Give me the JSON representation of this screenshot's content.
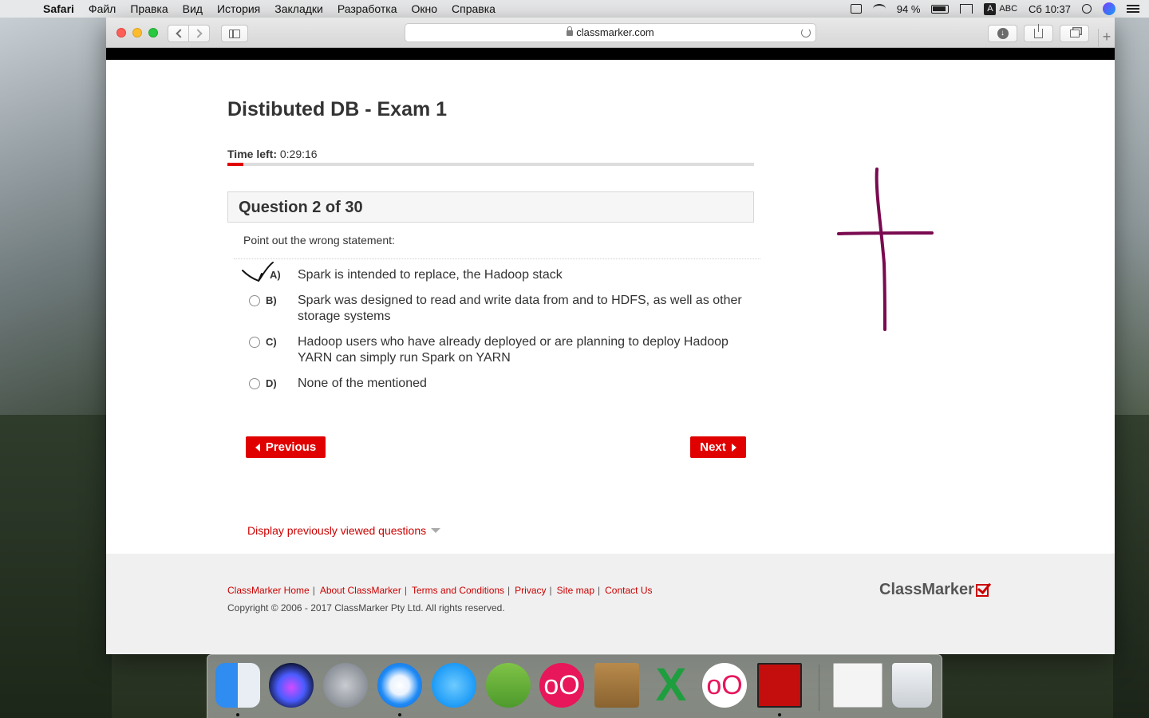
{
  "menubar": {
    "app": "Safari",
    "items": [
      "Файл",
      "Правка",
      "Вид",
      "История",
      "Закладки",
      "Разработка",
      "Окно",
      "Справка"
    ],
    "battery": "94 %",
    "input_source": "ABC",
    "clock": "Сб 10:37"
  },
  "browser": {
    "url": "classmarker.com"
  },
  "exam": {
    "title": "Distibuted DB - Exam 1",
    "time_left_label": "Time left:",
    "time_left_value": "0:29:16",
    "time_progress_fraction": 0.03,
    "question_header": "Question 2 of 30",
    "question_text": "Point out the wrong statement:",
    "answers": [
      {
        "letter": "A)",
        "text": "Spark is intended to replace, the Hadoop stack"
      },
      {
        "letter": "B)",
        "text": "Spark was designed to read and write data from and to HDFS, as well as other storage systems"
      },
      {
        "letter": "C)",
        "text": "Hadoop users who have already deployed or are planning to deploy Hadoop YARN can simply run Spark on YARN"
      },
      {
        "letter": "D)",
        "text": "None of the mentioned"
      }
    ],
    "previous_label": "Previous",
    "next_label": "Next",
    "prev_viewed_label": "Display previously viewed questions"
  },
  "footer": {
    "links": [
      "ClassMarker Home",
      "About ClassMarker",
      "Terms and Conditions",
      "Privacy",
      "Site map",
      "Contact Us"
    ],
    "copyright": "Copyright © 2006 - 2017 ClassMarker Pty Ltd. All rights reserved.",
    "brand": "ClassMarker"
  },
  "colors": {
    "accent_red": "#e00000",
    "annotation_purple": "#7a0a4f"
  },
  "dock": {
    "apps": [
      "finder-icon",
      "siri-icon",
      "launchpad-icon",
      "safari-icon",
      "messages-icon",
      "android-studio-icon",
      "oo-app-icon",
      "contacts-icon",
      "excel-icon",
      "oo-app-icon",
      "acrobat-icon",
      "preview-icon",
      "trash-icon"
    ],
    "oo_glyph": "oO"
  }
}
